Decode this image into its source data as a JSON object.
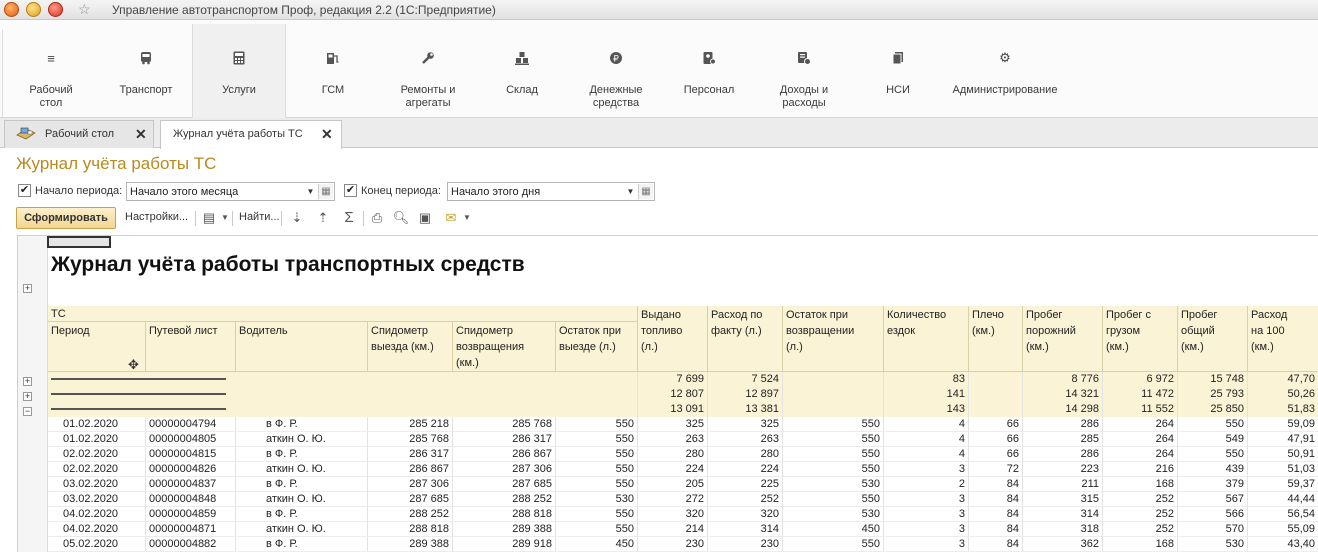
{
  "window": {
    "title": "Управление автотранспортом Проф, редакция 2.2  (1С:Предприятие)"
  },
  "sections": [
    {
      "label": "Рабочий\nстол",
      "icon": "menu-icon"
    },
    {
      "label": "Транспорт",
      "icon": "bus-icon"
    },
    {
      "label": "Услуги",
      "icon": "calculator-icon",
      "active": true
    },
    {
      "label": "ГСМ",
      "icon": "fuel-icon"
    },
    {
      "label": "Ремонты и\nагрегаты",
      "icon": "wrench-icon"
    },
    {
      "label": "Склад",
      "icon": "warehouse-icon"
    },
    {
      "label": "Денежные\nсредства",
      "icon": "coins-icon"
    },
    {
      "label": "Персонал",
      "icon": "personnel-icon"
    },
    {
      "label": "Доходы и\nрасходы",
      "icon": "income-icon"
    },
    {
      "label": "НСИ",
      "icon": "books-icon"
    },
    {
      "label": "Администрирование",
      "icon": "gear-icon"
    }
  ],
  "tabs": [
    {
      "label": "Рабочий стол"
    },
    {
      "label": "Журнал учёта работы ТС",
      "active": true
    }
  ],
  "form": {
    "title": "Журнал учёта работы ТС",
    "period_start_label": "Начало периода:",
    "period_start_value": "Начало этого месяца",
    "period_end_label": "Конец периода:",
    "period_end_value": "Начало этого дня",
    "checked_mark": "✔"
  },
  "toolbar": {
    "generate": "Сформировать",
    "settings": "Настройки...",
    "find": "Найти..."
  },
  "report": {
    "title": "Журнал учёта работы транспортных средств",
    "header_group": "ТС",
    "columns": [
      "Период",
      "Путевой лист",
      "Водитель",
      "Спидометр\nвыезда (км.)",
      "Спидометр\nвозвращения\n(км.)",
      "Остаток при\nвыезде (л.)",
      "Выдано\nтопливо\n(л.)",
      "Расход по\nфакту (л.)",
      "Остаток при\nвозвращении\n(л.)",
      "Количество\nездок",
      "Плечо\n(км.)",
      "Пробег\nпорожний\n(км.)",
      "Пробег с\nгрузом\n(км.)",
      "Пробег\nобщий\n(км.)",
      "Расход\nна 100\n(км.)"
    ],
    "groups": [
      {
        "fuel_issued": "7 699",
        "fuel_actual": "7 524",
        "trips": "83",
        "empty_run": "8 776",
        "loaded_run": "6 972",
        "total_run": "15 748",
        "per100": "47,70"
      },
      {
        "fuel_issued": "12 807",
        "fuel_actual": "12 897",
        "trips": "141",
        "empty_run": "14 321",
        "loaded_run": "11 472",
        "total_run": "25 793",
        "per100": "50,26"
      },
      {
        "fuel_issued": "13 091",
        "fuel_actual": "13 381",
        "trips": "143",
        "empty_run": "14 298",
        "loaded_run": "11 552",
        "total_run": "25 850",
        "per100": "51,83"
      }
    ],
    "rows": [
      [
        "01.02.2020",
        "00000004794",
        "в Ф. Р.",
        "285 218",
        "285 768",
        "550",
        "325",
        "325",
        "550",
        "4",
        "66",
        "286",
        "264",
        "550",
        "59,09"
      ],
      [
        "01.02.2020",
        "00000004805",
        "аткин О. Ю.",
        "285 768",
        "286 317",
        "550",
        "263",
        "263",
        "550",
        "4",
        "66",
        "285",
        "264",
        "549",
        "47,91"
      ],
      [
        "02.02.2020",
        "00000004815",
        "в Ф. Р.",
        "286 317",
        "286 867",
        "550",
        "280",
        "280",
        "550",
        "4",
        "66",
        "286",
        "264",
        "550",
        "50,91"
      ],
      [
        "02.02.2020",
        "00000004826",
        "аткин О. Ю.",
        "286 867",
        "287 306",
        "550",
        "224",
        "224",
        "550",
        "3",
        "72",
        "223",
        "216",
        "439",
        "51,03"
      ],
      [
        "03.02.2020",
        "00000004837",
        "в Ф. Р.",
        "287 306",
        "287 685",
        "550",
        "205",
        "225",
        "530",
        "2",
        "84",
        "211",
        "168",
        "379",
        "59,37"
      ],
      [
        "03.02.2020",
        "00000004848",
        "аткин О. Ю.",
        "287 685",
        "288 252",
        "530",
        "272",
        "252",
        "550",
        "3",
        "84",
        "315",
        "252",
        "567",
        "44,44"
      ],
      [
        "04.02.2020",
        "00000004859",
        "в Ф. Р.",
        "288 252",
        "288 818",
        "550",
        "320",
        "320",
        "530",
        "3",
        "84",
        "314",
        "252",
        "566",
        "56,54"
      ],
      [
        "04.02.2020",
        "00000004871",
        "аткин О. Ю.",
        "288 818",
        "289 388",
        "550",
        "214",
        "314",
        "450",
        "3",
        "84",
        "318",
        "252",
        "570",
        "55,09"
      ],
      [
        "05.02.2020",
        "00000004882",
        "в Ф. Р.",
        "289 388",
        "289 918",
        "450",
        "230",
        "230",
        "550",
        "3",
        "84",
        "362",
        "168",
        "530",
        "43,40"
      ]
    ]
  },
  "colors": {
    "accent_title": "#b98a1e",
    "header_band": "#faf3d6",
    "button_generate": "#f2d68f"
  }
}
